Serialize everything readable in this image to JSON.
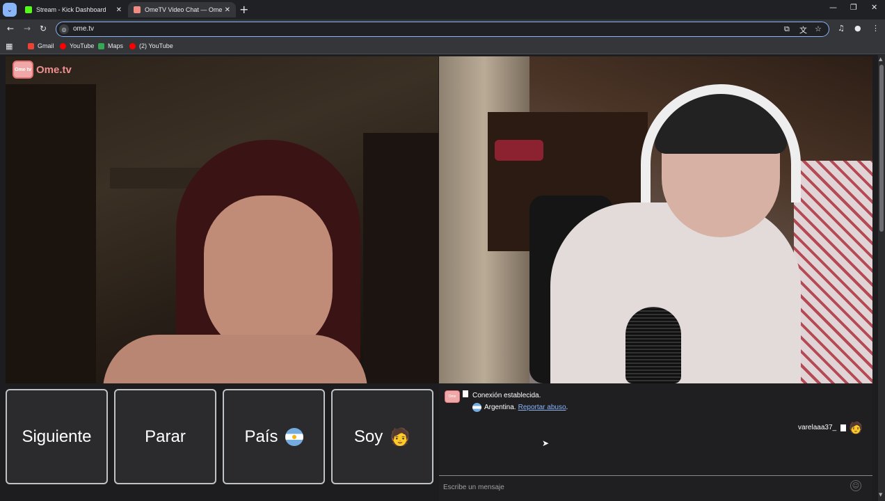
{
  "browser": {
    "tabs": [
      {
        "title": "Stream - Kick Dashboard",
        "favicon_color": "#53fc18",
        "active": false
      },
      {
        "title": "OmeTV Video Chat — Ome",
        "favicon_color": "#f28b82",
        "active": true
      }
    ],
    "url": "ome.tv",
    "bookmarks": [
      {
        "label": "Gmail",
        "icon_color": "#ea4335"
      },
      {
        "label": "YouTube",
        "icon_color": "#ff0000"
      },
      {
        "label": "Maps",
        "icon_color": "#34a853"
      },
      {
        "label": "(2) YouTube",
        "icon_color": "#ff0000"
      }
    ]
  },
  "ometv": {
    "logo_box": "Ome tv",
    "logo_text": "Ome.tv",
    "buttons": {
      "next": "Siguiente",
      "stop": "Parar",
      "country": "País",
      "gender": "Soy",
      "gender_icon": "🧑"
    },
    "chat": {
      "connection": "Conexión establecida.",
      "country": "Argentina.",
      "report_link": "Reportar abuso",
      "report_suffix": ".",
      "username": "varelaaa37_",
      "user_icon": "🧑",
      "input_placeholder": "Escribe un mensaje"
    }
  }
}
